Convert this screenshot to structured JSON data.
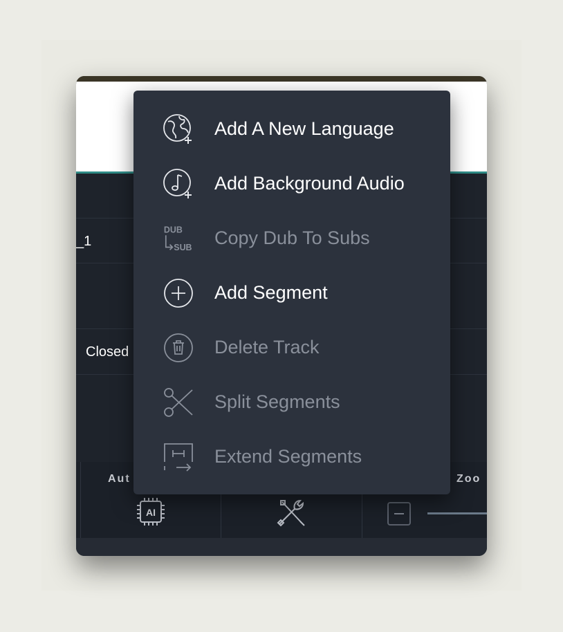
{
  "context_menu": {
    "items": [
      {
        "label": "Add A New Language",
        "icon": "globe-plus-icon",
        "enabled": true
      },
      {
        "label": "Add Background Audio",
        "icon": "music-note-plus-icon",
        "enabled": true
      },
      {
        "label": "Copy Dub To Subs",
        "icon": "dub-to-sub-icon",
        "icon_text_top": "DUB",
        "icon_text_bottom": "SUB",
        "enabled": false
      },
      {
        "label": "Add Segment",
        "icon": "plus-circle-icon",
        "enabled": true
      },
      {
        "label": "Delete Track",
        "icon": "trash-icon",
        "enabled": false
      },
      {
        "label": "Split Segments",
        "icon": "scissors-icon",
        "enabled": false
      },
      {
        "label": "Extend Segments",
        "icon": "extend-icon",
        "enabled": false
      }
    ]
  },
  "tracks": {
    "row1_label": "_1",
    "row3_label": "Closed"
  },
  "bottom_bar": {
    "auto_label": "Aut",
    "zoom_label": "Zoo",
    "ai_icon_text": "AI"
  },
  "colors": {
    "menu_bg": "#2c323d",
    "enabled_text": "#ffffff",
    "disabled_text": "#8a909b",
    "teal_accent": "#2f8c87"
  }
}
